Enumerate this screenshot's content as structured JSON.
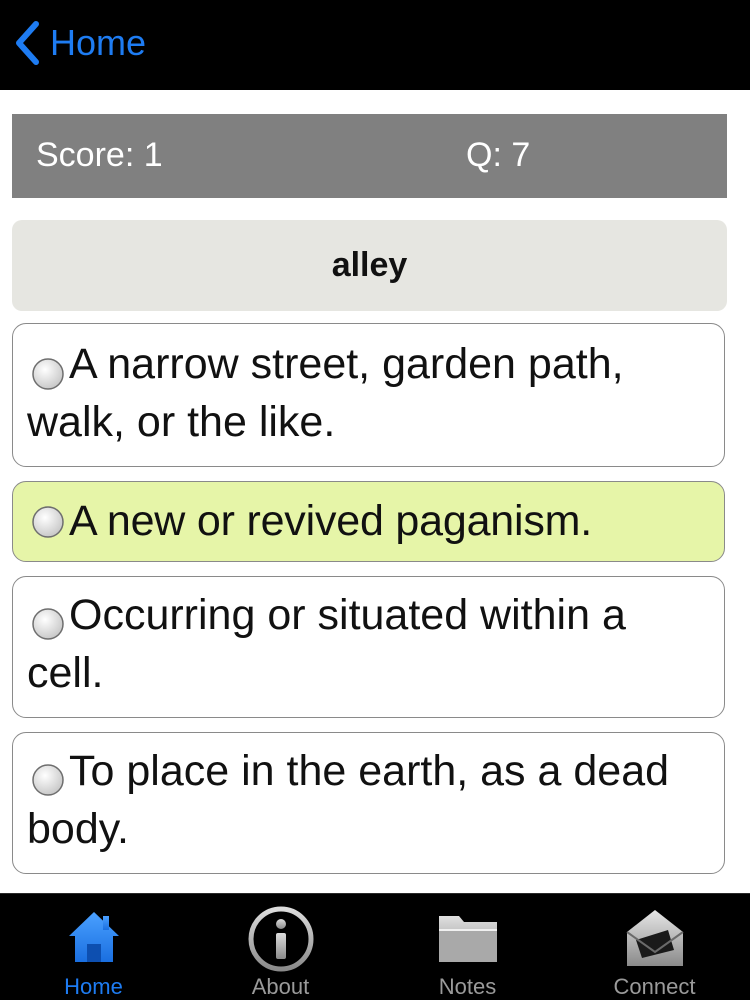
{
  "navbar": {
    "back_label": "Home",
    "back_icon": "chevron-left-icon"
  },
  "scorebar": {
    "score_text": "Score: 1",
    "question_text": "Q: 7"
  },
  "quiz": {
    "word": "alley",
    "options": [
      {
        "text": "A narrow street, garden path, walk, or the like.",
        "highlighted": false
      },
      {
        "text": "A new or revived paganism.",
        "highlighted": true
      },
      {
        "text": "Occurring or situated within a cell.",
        "highlighted": false
      },
      {
        "text": "To place in the earth, as a dead body.",
        "highlighted": false
      }
    ]
  },
  "tabs": [
    {
      "label": "Home",
      "icon": "house-icon",
      "active": true
    },
    {
      "label": "About",
      "icon": "info-icon",
      "active": false
    },
    {
      "label": "Notes",
      "icon": "folder-icon",
      "active": false
    },
    {
      "label": "Connect",
      "icon": "envelope-icon",
      "active": false
    }
  ],
  "colors": {
    "accent": "#1e7cf2",
    "scorebar_bg": "#808080",
    "wordbox_bg": "#e6e6e1",
    "highlight_bg": "#e6f5a8",
    "bar_bg": "#000000"
  }
}
